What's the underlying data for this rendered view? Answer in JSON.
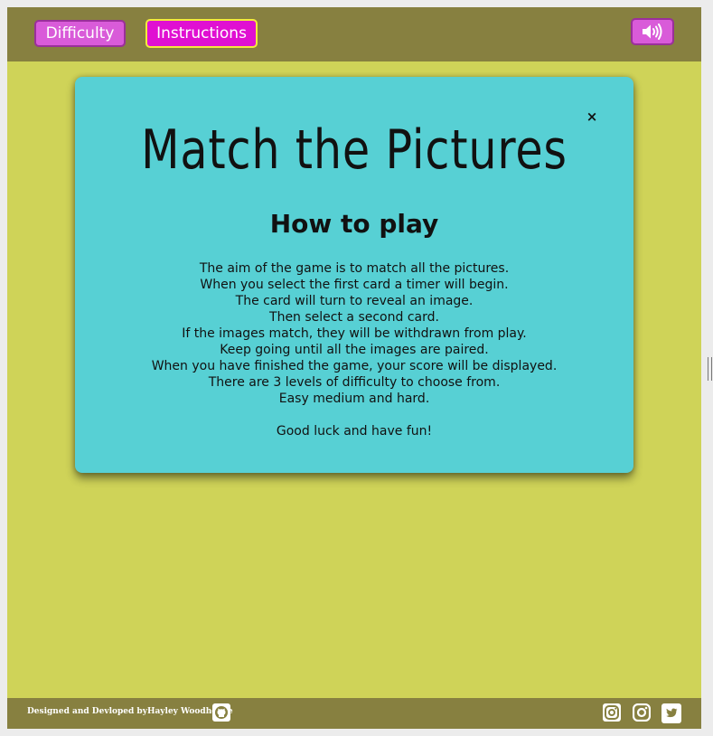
{
  "topbar": {
    "difficulty_label": "Difficulty",
    "instructions_label": "Instructions",
    "sound_icon": "speaker-volume-icon"
  },
  "modal": {
    "close_label": "×",
    "title": "Match the Pictures",
    "heading": "How to play",
    "lines": [
      "The aim of the game is to match all the pictures.",
      "When you select the first card a timer will begin.",
      "The card will turn to reveal an image.",
      "Then select a second card.",
      "If the images match, they will be withdrawn from play.",
      "Keep going until all the images are paired.",
      "When you have finished the game, your score will be displayed.",
      "There are 3 levels of difficulty to choose from.",
      "Easy medium and hard."
    ],
    "closing": "Good luck and have fun!"
  },
  "footer": {
    "credit": "Designed and Devloped byHayley Woodhouse",
    "icons": [
      "github-icon",
      "instagram-icon",
      "instagram-icon",
      "twitter-icon"
    ]
  },
  "colors": {
    "page_bg": "#cfd358",
    "bar_bg": "#878040",
    "modal_bg": "#57d0d4",
    "button_bg": "#d95bd9",
    "button_active_bg": "#e010d2",
    "active_border": "#f3ea3c"
  }
}
